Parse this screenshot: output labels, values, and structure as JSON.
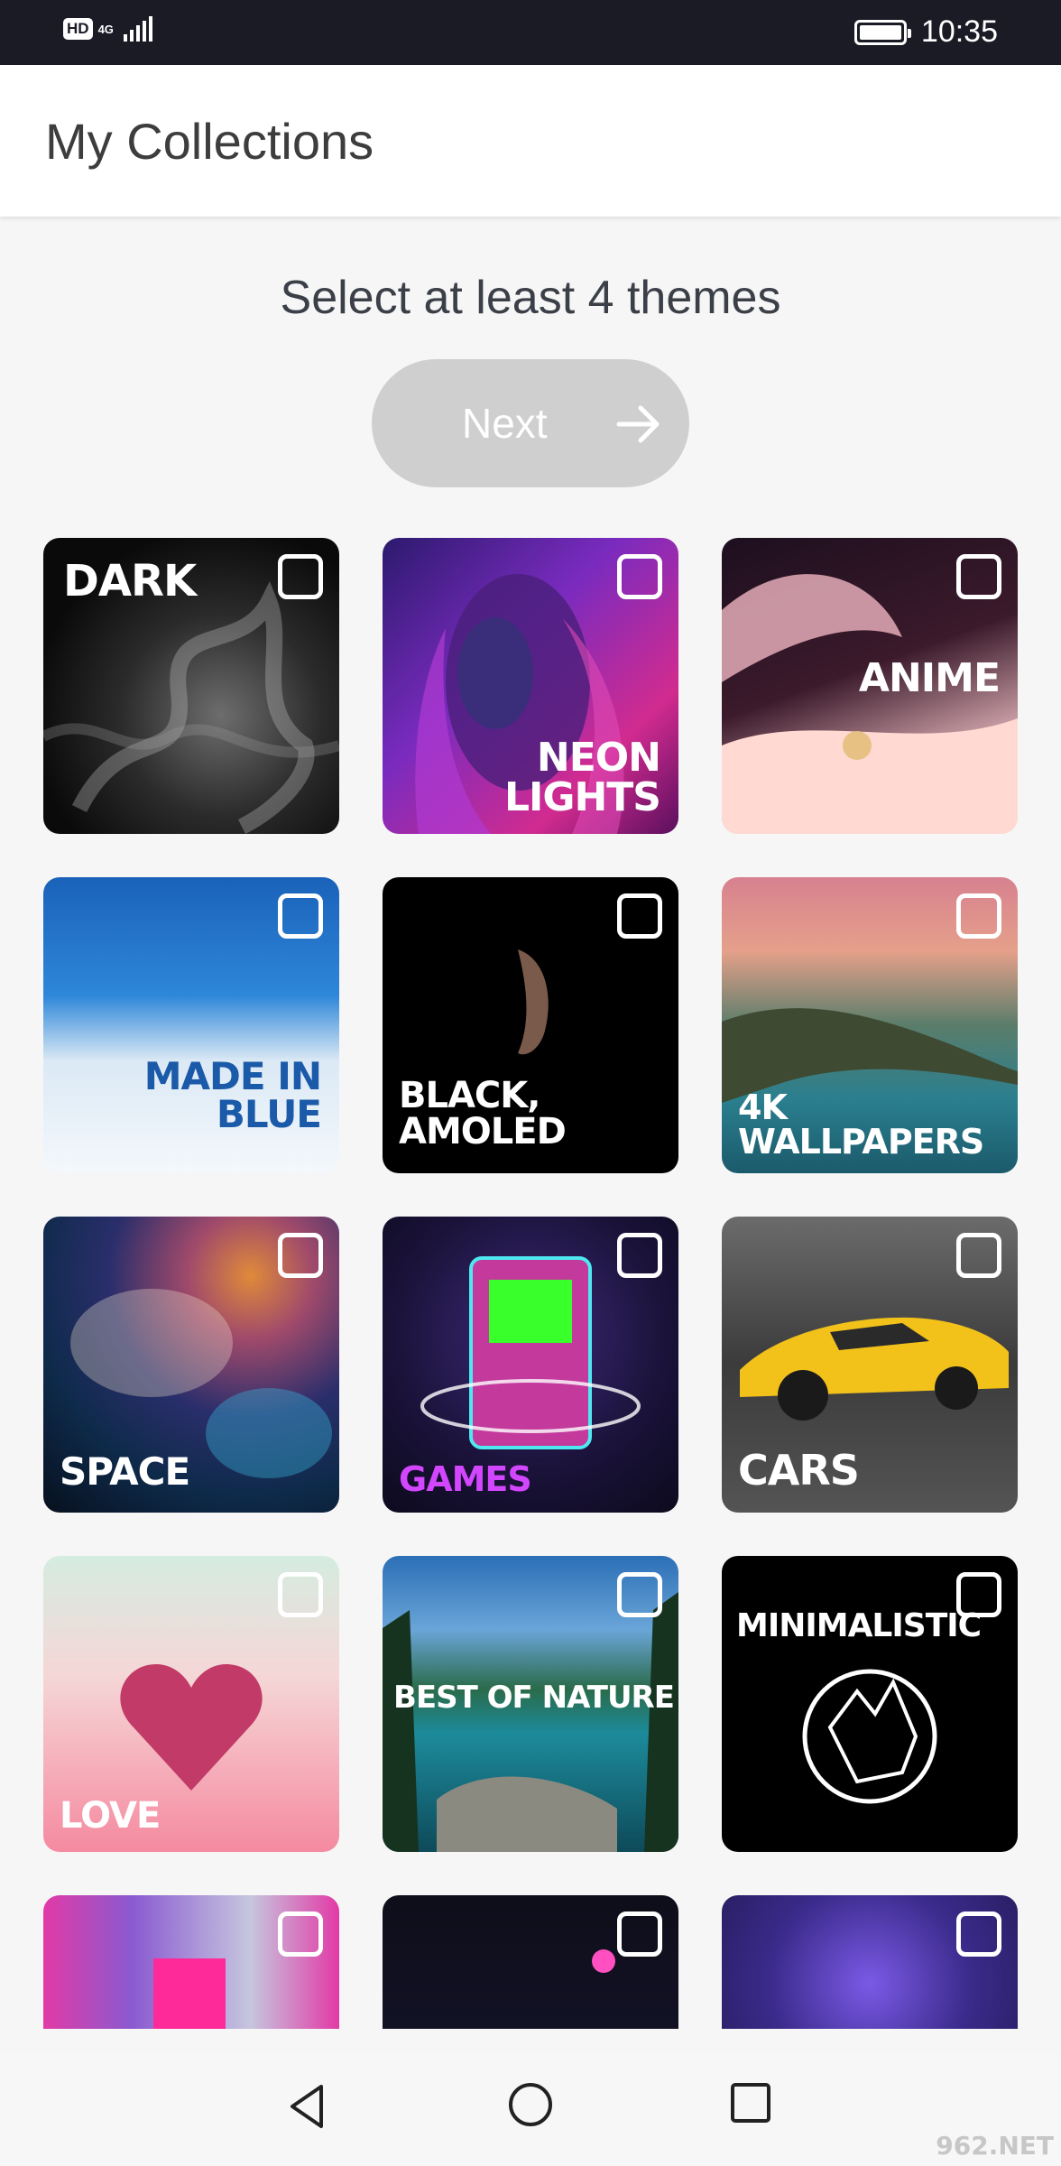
{
  "status_bar": {
    "hd": "HD",
    "network": "4G",
    "time": "10:35"
  },
  "app_bar": {
    "title": "My Collections"
  },
  "subtitle": "Select at least 4 themes",
  "next_button": {
    "label": "Next",
    "enabled": false
  },
  "themes": [
    {
      "id": "dark",
      "label": "DARK",
      "checked": false
    },
    {
      "id": "neon",
      "label": "NEON LIGHTS",
      "checked": false
    },
    {
      "id": "anime",
      "label": "ANIME",
      "checked": false
    },
    {
      "id": "blue",
      "label": "MADE IN BLUE",
      "checked": false
    },
    {
      "id": "amoled",
      "label": "BLACK, AMOLED",
      "checked": false
    },
    {
      "id": "4k",
      "label": "4K WALLPAPERS",
      "checked": false
    },
    {
      "id": "space",
      "label": "SPACE",
      "checked": false
    },
    {
      "id": "games",
      "label": "GAMES",
      "checked": false
    },
    {
      "id": "cars",
      "label": "CARS",
      "checked": false
    },
    {
      "id": "love",
      "label": "LOVE",
      "checked": false
    },
    {
      "id": "nature",
      "label": "BEST OF NATURE",
      "checked": false
    },
    {
      "id": "minimal",
      "label": "MINIMALISTIC",
      "checked": false
    },
    {
      "id": "row5a",
      "label": "",
      "checked": false
    },
    {
      "id": "row5b",
      "label": "",
      "checked": false
    },
    {
      "id": "row5c",
      "label": "",
      "checked": false
    }
  ],
  "watermark": "962.NET",
  "colors": {
    "status_bar": "#1b1b26",
    "button_disabled": "#cfcfcf",
    "title_text": "#3d3d3d"
  }
}
